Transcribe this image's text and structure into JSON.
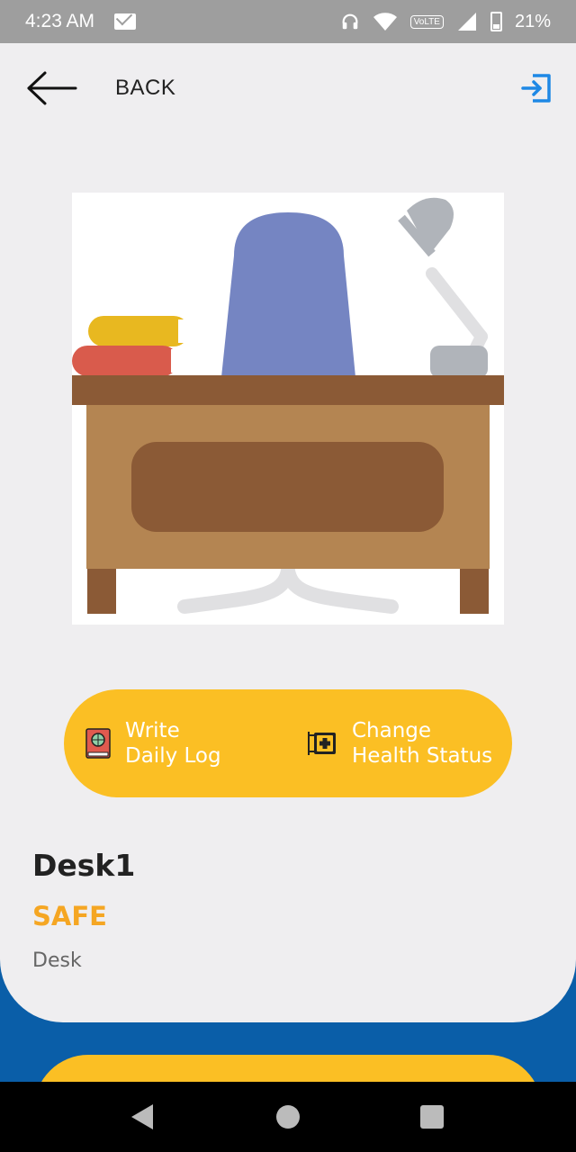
{
  "status_bar": {
    "time": "4:23 AM",
    "battery": "21%",
    "icons": [
      "mail-icon",
      "headphones-icon",
      "wifi-icon",
      "volte-icon",
      "signal-icon",
      "battery-icon"
    ],
    "volte_text": "VoLTE"
  },
  "header": {
    "back_label": "BACK",
    "exit_icon": "exit-icon"
  },
  "actions": {
    "daily_log": {
      "line1": "Write",
      "line2": "Daily Log",
      "icon": "book-icon"
    },
    "health": {
      "line1": "Change",
      "line2": "Health Status",
      "icon": "medical-sign-icon"
    }
  },
  "item": {
    "name": "Desk1",
    "status": "SAFE",
    "type": "Desk"
  },
  "colors": {
    "accent_yellow": "#fbbf24",
    "status_safe": "#f5a623",
    "background_blue": "#0a5ea8",
    "card_bg": "#efeef0",
    "icon_blue": "#1e88e5"
  }
}
